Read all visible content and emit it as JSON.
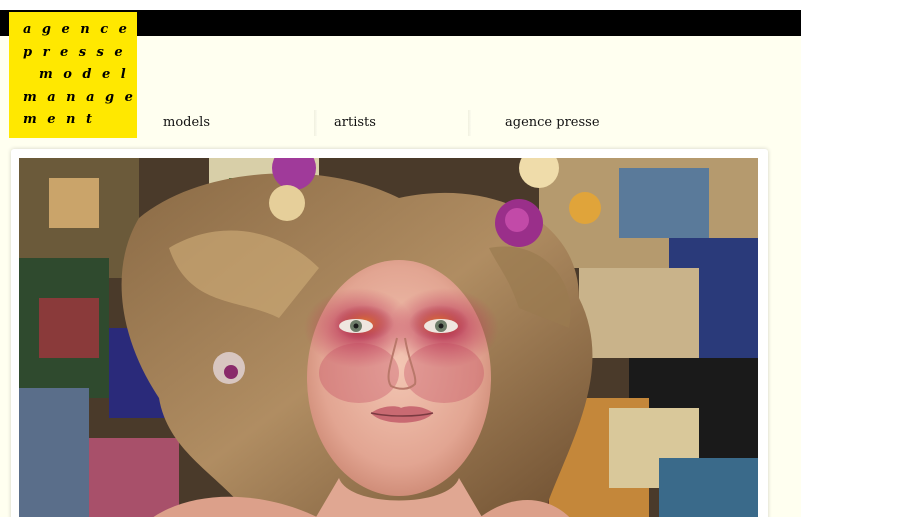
{
  "logo": {
    "lines": [
      "agence",
      "presse",
      "model",
      "manage",
      "ment"
    ],
    "bg_color": "#ffe800"
  },
  "nav": {
    "items": [
      {
        "label": "models"
      },
      {
        "label": "artists"
      },
      {
        "label": "agence presse"
      }
    ]
  },
  "colors": {
    "topbar": "#000000",
    "page_background": "#fffff0",
    "accent_yellow": "#ffe800"
  },
  "hero": {
    "type": "editorial-photo"
  }
}
